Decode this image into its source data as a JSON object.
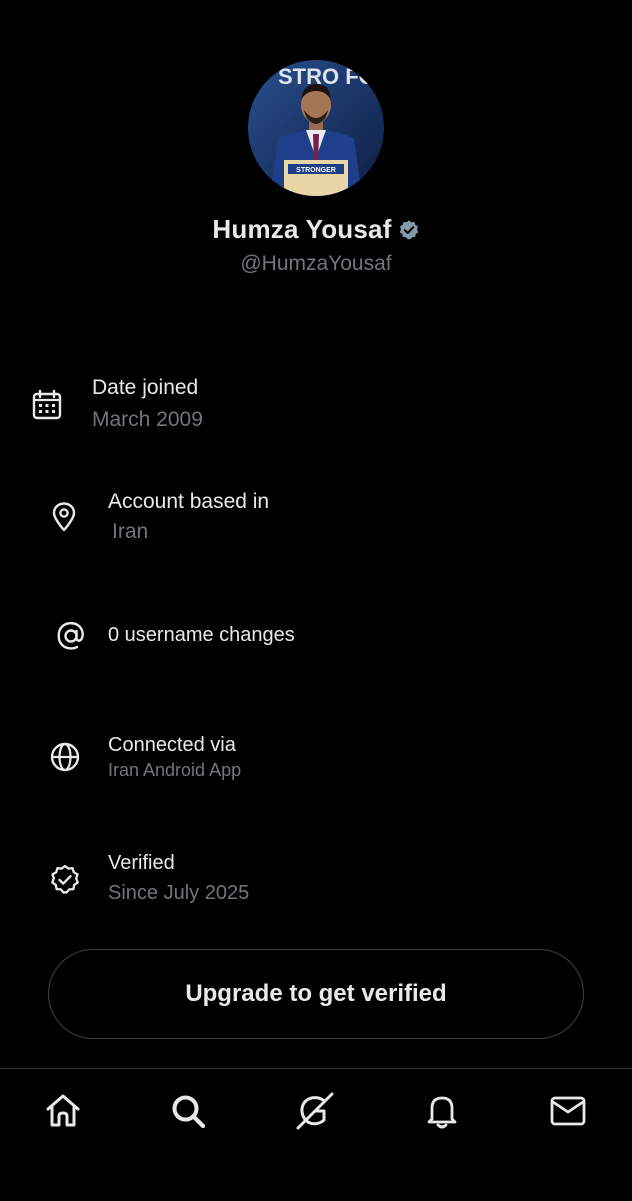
{
  "profile": {
    "name": "Humza Yousaf",
    "handle": "@HumzaYousaf",
    "verified": true,
    "avatar_podium_text": "STRONGER",
    "avatar_background_text": "STRO FOR SCOT"
  },
  "about": {
    "date_joined": {
      "icon": "calendar-icon",
      "title": "Date joined",
      "value": "March 2009"
    },
    "account_based_in": {
      "icon": "location-pin-icon",
      "title": "Account based in",
      "value": "Iran"
    },
    "username_changes": {
      "icon": "at-sign-icon",
      "title": "0 username changes"
    },
    "connected_via": {
      "icon": "globe-icon",
      "title": "Connected via",
      "value": "Iran Android App"
    },
    "verified": {
      "icon": "verified-check-icon",
      "title": "Verified",
      "value": "Since July 2025"
    }
  },
  "upgrade_button_label": "Upgrade to get verified",
  "bottom_nav": {
    "items": [
      {
        "icon": "home-icon",
        "label": "Home"
      },
      {
        "icon": "search-icon",
        "label": "Explore"
      },
      {
        "icon": "grok-icon",
        "label": "Grok"
      },
      {
        "icon": "bell-icon",
        "label": "Notifications"
      },
      {
        "icon": "mail-icon",
        "label": "Messages"
      }
    ]
  },
  "colors": {
    "background": "#000000",
    "primary_text": "#e7e9ea",
    "secondary_text": "#71767b",
    "verified_badge": "#829aab",
    "border": "#2f3336"
  }
}
